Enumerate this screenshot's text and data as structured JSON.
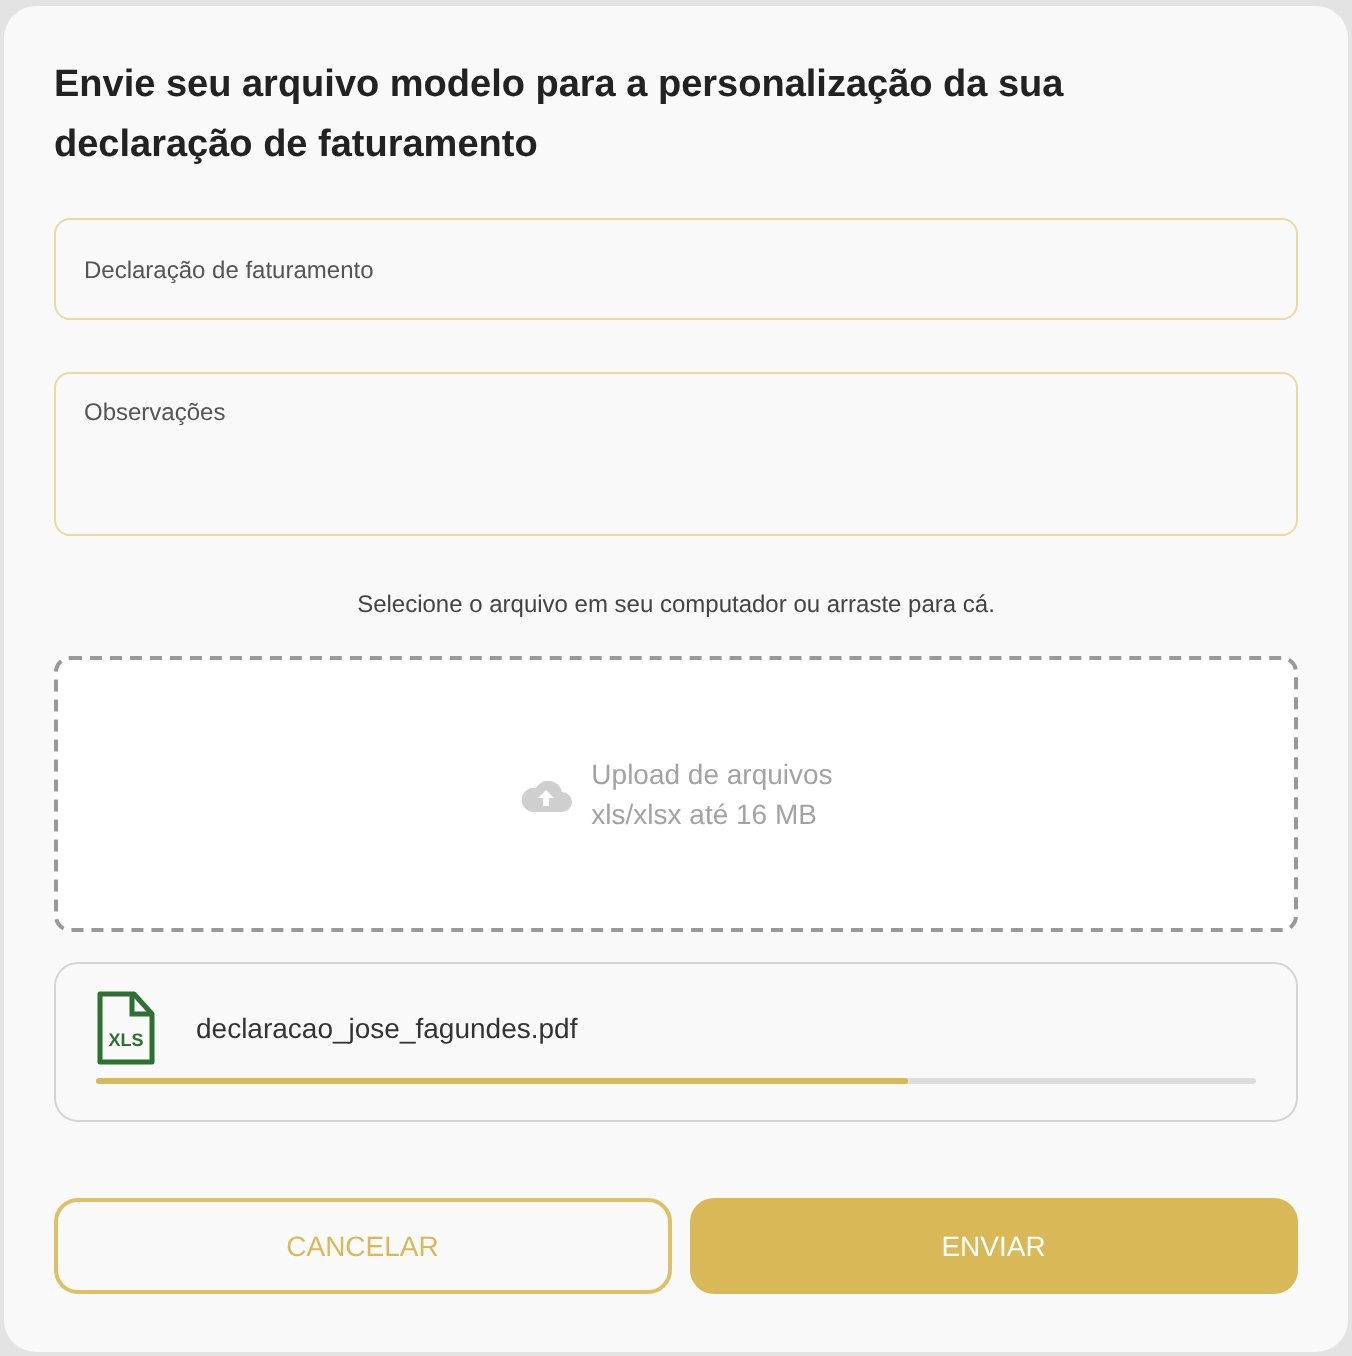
{
  "dialog": {
    "title": "Envie seu arquivo modelo para a personalização da sua declaração de faturamento",
    "fields": [
      {
        "placeholder": "Declaração de faturamento",
        "kind": "input"
      },
      {
        "placeholder": "Observações",
        "kind": "textarea"
      }
    ],
    "helper_text": "Selecione o arquivo em seu computador ou arraste para cá.",
    "dropzone": {
      "title": "Upload de arquivos",
      "subtitle": "xls/xlsx até 16 MB"
    },
    "file": {
      "icon_label": "XLS",
      "name": "declaracao_jose_fagundes.pdf",
      "level": 0.7
    },
    "buttons": [
      {
        "label": "CANCELAR",
        "kind": "secondary"
      },
      {
        "label": "ENVIAR",
        "kind": "primary"
      }
    ]
  }
}
